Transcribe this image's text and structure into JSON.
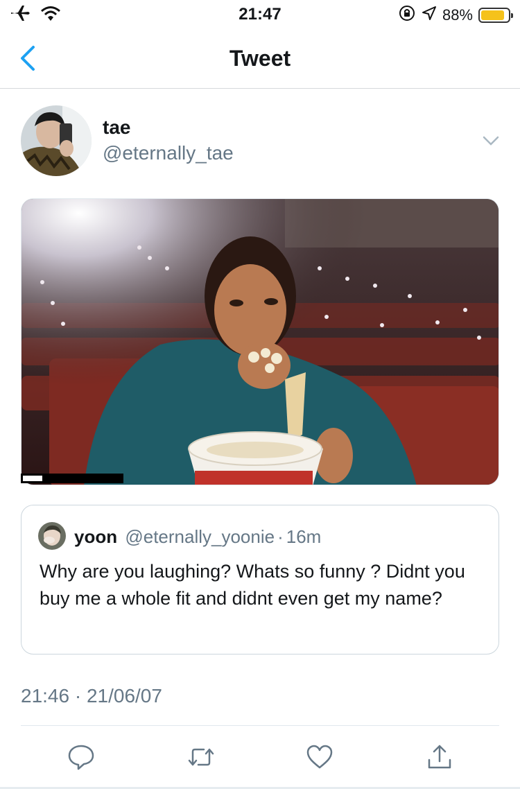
{
  "status_bar": {
    "time": "21:47",
    "battery_percent": "88%",
    "battery_level": 0.88,
    "icons": [
      "airplane-icon",
      "wifi-icon",
      "rotation-lock-icon",
      "location-icon",
      "battery-icon"
    ]
  },
  "nav": {
    "title": "Tweet",
    "back_icon": "chevron-left-icon"
  },
  "tweet": {
    "author": {
      "name": "tae",
      "handle": "@eternally_tae"
    },
    "media": {
      "video_progress": 0.2
    },
    "quoted": {
      "name": "yoon",
      "handle": "@eternally_yoonie",
      "separator": "·",
      "age": "16m",
      "text": "Why are you laughing? Whats so funny ? Didnt you buy me a whole fit and didnt even get my name?"
    },
    "timestamp": "21:46 · 21/06/07"
  },
  "actions": [
    "reply-icon",
    "retweet-icon",
    "like-icon",
    "share-icon"
  ],
  "colors": {
    "accent": "#1da1f2",
    "secondary_text": "#657786",
    "icon": "#657786",
    "battery": "#f5c21b"
  }
}
